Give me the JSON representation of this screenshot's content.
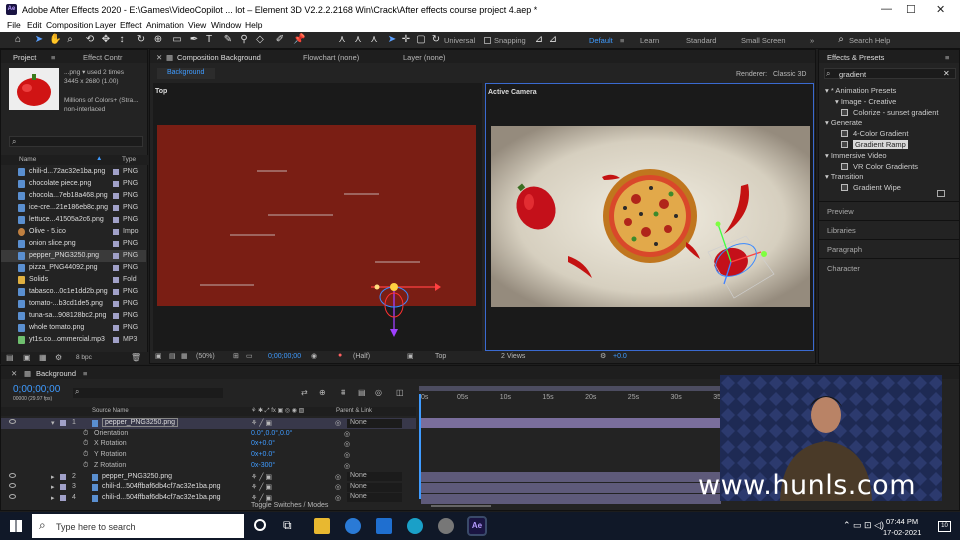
{
  "window": {
    "app_icon": "Ae",
    "title": "Adobe After Effects 2020 - E:\\Games\\VideoCopilot ... lot – Element 3D V2.2.2.2168 Win\\Crack\\After effects course project 4.aep *",
    "controls": {
      "minimize": "—",
      "maximize": "☐",
      "close": "✕"
    }
  },
  "menu": [
    "File",
    "Edit",
    "Composition",
    "Layer",
    "Effect",
    "Animation",
    "View",
    "Window",
    "Help"
  ],
  "toolbar": {
    "universal": "Universal",
    "snapping": "Snapping",
    "workspaces": [
      "Default",
      "Learn",
      "Standard",
      "Small Screen"
    ],
    "search_placeholder": "Search Help",
    "active_workspace": "Default",
    "more": "»",
    "menu": "≡"
  },
  "project": {
    "tab": "Project",
    "tab2": "Effect Contr",
    "thumb_info": {
      "name": "...png",
      "used": "▾ used 2 times",
      "size": "3445 x 2680 (1.00)",
      "colors": "Millions of Colors+ (Stra...",
      "interlace": "non-interlaced"
    },
    "search_icon": "⌕",
    "columns": {
      "name": "Name",
      "type": "Type"
    },
    "items": [
      {
        "name": "chili-d...72ac32e1ba.png",
        "type": "PNG",
        "kind": "img"
      },
      {
        "name": "chocolate piece.png",
        "type": "PNG",
        "kind": "img"
      },
      {
        "name": "chocola...7eb18a468.png",
        "type": "PNG",
        "kind": "img"
      },
      {
        "name": "ice-cre...21e186eb8c.png",
        "type": "PNG",
        "kind": "img"
      },
      {
        "name": "lettuce...41505a2c6.png",
        "type": "PNG",
        "kind": "img"
      },
      {
        "name": "Olive - 5.ico",
        "type": "Impo",
        "kind": "ico"
      },
      {
        "name": "onion slice.png",
        "type": "PNG",
        "kind": "img"
      },
      {
        "name": "pepper_PNG3250.png",
        "type": "PNG",
        "kind": "img"
      },
      {
        "name": "pizza_PNG44092.png",
        "type": "PNG",
        "kind": "img"
      },
      {
        "name": "Solids",
        "type": "Fold",
        "kind": "fold"
      },
      {
        "name": "tabasco...0c1e1dd2b.png",
        "type": "PNG",
        "kind": "img"
      },
      {
        "name": "tomato-...b3cd1de5.png",
        "type": "PNG",
        "kind": "img"
      },
      {
        "name": "tuna-sa...908128bc2.png",
        "type": "PNG",
        "kind": "img"
      },
      {
        "name": "whole tomato.png",
        "type": "PNG",
        "kind": "img"
      },
      {
        "name": "yt1s.co...ommercial.mp3",
        "type": "MP3",
        "kind": "aud"
      }
    ],
    "bpc": "8 bpc"
  },
  "comp": {
    "tab": "Composition Background",
    "flowchart": "Flowchart (none)",
    "layer": "Layer (none)",
    "breadcrumb": "Background",
    "renderer_label": "Renderer:",
    "renderer": "Classic 3D",
    "view_left": "Top",
    "view_right": "Active Camera",
    "footer": {
      "zoom": "(50%)",
      "time": "0;00;00;00",
      "resolution": "(Half)",
      "view": "Top",
      "views": "2 Views",
      "exposure": "+0.0"
    },
    "bg_left": "#7a1e14"
  },
  "effects": {
    "tab": "Effects & Presets",
    "search": "gradient",
    "tree": [
      {
        "label": "▾ * Animation Presets",
        "level": 0
      },
      {
        "label": "▾ Image - Creative",
        "level": 1
      },
      {
        "label": "Colorize - sunset gradient",
        "level": 2,
        "icon": true
      },
      {
        "label": "▾ Generate",
        "level": 0
      },
      {
        "label": "4-Color Gradient",
        "level": 2,
        "icon": true
      },
      {
        "label": "Gradient Ramp",
        "level": 2,
        "icon": true,
        "selected": true
      },
      {
        "label": "▾ Immersive Video",
        "level": 0
      },
      {
        "label": "VR Color Gradients",
        "level": 2,
        "icon": true
      },
      {
        "label": "▾ Transition",
        "level": 0
      },
      {
        "label": "Gradient Wipe",
        "level": 2,
        "icon": true
      }
    ],
    "collapsed": [
      "Preview",
      "Libraries",
      "Paragraph",
      "Character"
    ]
  },
  "timeline": {
    "tab": "Background",
    "time": "0;00;00;00",
    "fps": "00000 (29.97 fps)",
    "col_source": "Source Name",
    "col_parent": "Parent & Link",
    "layers": [
      {
        "num": "1",
        "name": "pepper_PNG3250.png",
        "parent": "None",
        "selected": true
      },
      {
        "prop": "Orientation",
        "value": "0.0°,0.0°,0.0°"
      },
      {
        "prop": "X Rotation",
        "value": "0x+0.0°"
      },
      {
        "prop": "Y Rotation",
        "value": "0x+0.0°"
      },
      {
        "prop": "Z Rotation",
        "value": "0x-300°"
      },
      {
        "num": "2",
        "name": "pepper_PNG3250.png",
        "parent": "None"
      },
      {
        "num": "3",
        "name": "chili-d...504ffbaf6db4cf7ac32e1ba.png",
        "parent": "None"
      },
      {
        "num": "4",
        "name": "chili-d...504ffbaf6db4cf7ac32e1ba.png",
        "parent": "None"
      }
    ],
    "ruler": [
      "0s",
      "05s",
      "10s",
      "15s",
      "20s",
      "25s",
      "30s",
      "35"
    ],
    "toggle": "Toggle Switches / Modes"
  },
  "watermark": "www.hunls.com",
  "taskbar": {
    "search_placeholder": "Type here to search",
    "time": "07:44 PM",
    "date": "17-02-2021",
    "notif": "10",
    "ae_label": "Ae"
  }
}
